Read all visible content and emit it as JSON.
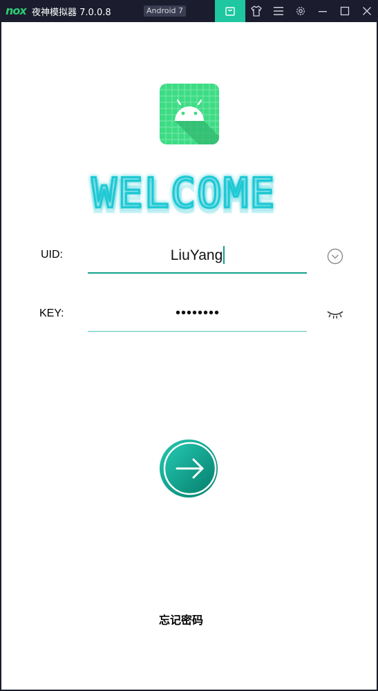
{
  "window": {
    "logo_text": "nox",
    "app_title": "夜神模拟器 7.0.0.8",
    "android_badge": "Android 7",
    "toolbar_icons": [
      "store-bag-icon",
      "shirt-icon",
      "menu-icon",
      "gear-icon",
      "minimize-icon",
      "maximize-icon",
      "close-icon"
    ]
  },
  "welcome": {
    "text": "WELCOME",
    "color": "#1ec8d4"
  },
  "form": {
    "uid_label": "UID:",
    "uid_value": "LiuYang",
    "key_label": "KEY:",
    "key_value": "••••••••",
    "accent_color": "#11a089"
  },
  "login": {
    "icon": "arrow-right-icon"
  },
  "forgot_password": "忘记密码"
}
